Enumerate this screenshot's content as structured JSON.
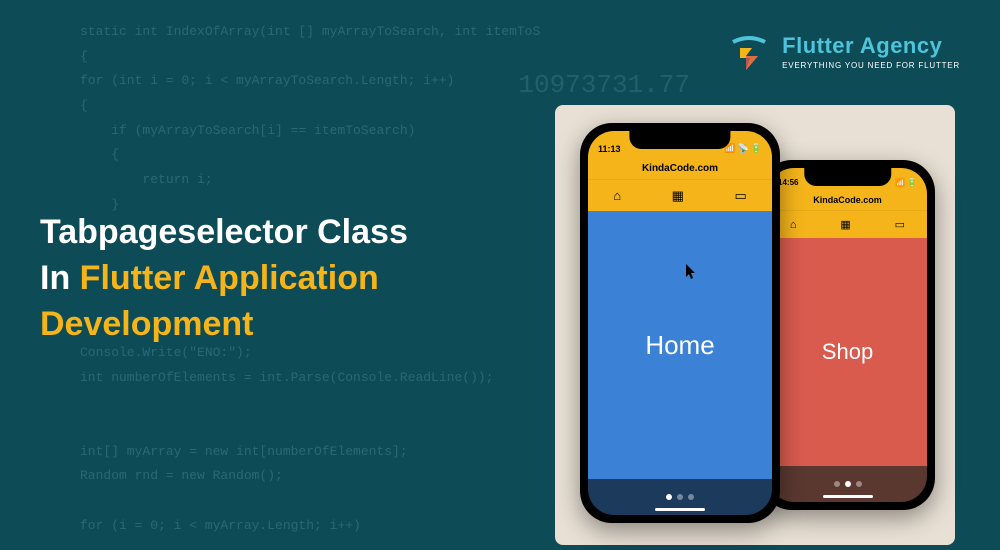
{
  "logo": {
    "title": "Flutter Agency",
    "subtitle": "EVERYTHING YOU NEED FOR FLUTTER"
  },
  "headline": {
    "line1_white": "Tabpageselector Class",
    "line2_white": "In ",
    "line2_gold": "Flutter Application",
    "line3_gold": "Development"
  },
  "background": {
    "code": "static int IndexOfArray(int [] myArrayToSearch, int itemToS\n{\nfor (int i = 0; i < myArrayToSearch.Length; i++)\n{\n    if (myArrayToSearch[i] == itemToSearch)\n    {\n        return i;\n    }\n}\n\n\n\n\nConsole.Write(\"ENO:\");\nint numberOfElements = int.Parse(Console.ReadLine());\n\n\nint[] myArray = new int[numberOfElements];\nRandom rnd = new Random();\n\nfor (i = 0; i < myArray.Length; i++)",
    "floating_number": "10973731.77"
  },
  "phone_front": {
    "status_time": "11:13",
    "app_title": "KindaCode.com",
    "tabs": {
      "home": "home-icon",
      "calendar": "calendar-icon",
      "card": "card-icon"
    },
    "content_label": "Home",
    "content_color": "#3b82d6",
    "page_dots": {
      "total": 3,
      "active": 0
    }
  },
  "phone_back": {
    "status_time": "14:56",
    "app_title": "KindaCode.com",
    "tabs": {
      "home": "home-icon",
      "calendar": "calendar-icon",
      "card": "card-icon"
    },
    "content_label": "Shop",
    "content_color": "#d95b4e",
    "page_dots": {
      "total": 3,
      "active": 1
    }
  }
}
